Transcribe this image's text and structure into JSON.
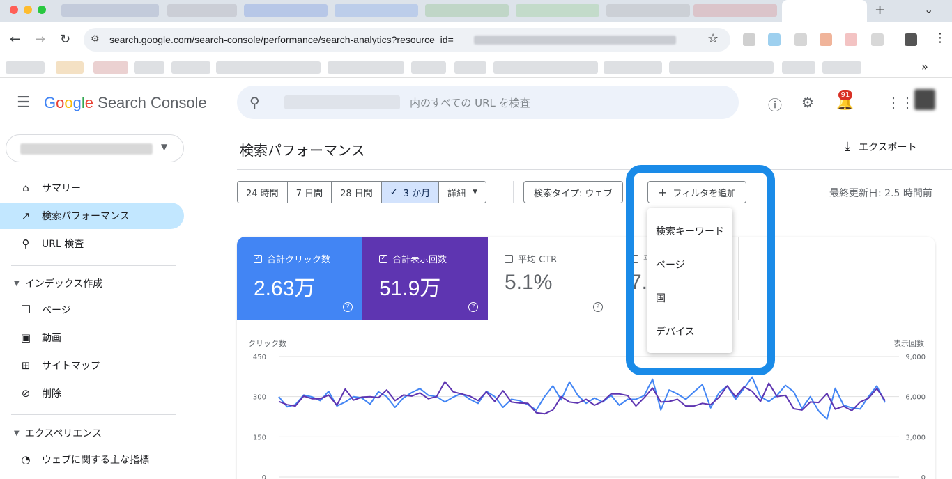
{
  "browser": {
    "url": "search.google.com/search-console/performance/search-analytics?resource_id="
  },
  "header": {
    "logo_google": [
      "G",
      "o",
      "o",
      "g",
      "l",
      "e"
    ],
    "logo_product": "Search Console",
    "search_placeholder": "内のすべての URL を検査",
    "notification_count": "91"
  },
  "sidebar": {
    "items": [
      {
        "label": "サマリー",
        "icon": "home-icon"
      },
      {
        "label": "検索パフォーマンス",
        "icon": "trending-up-icon"
      },
      {
        "label": "URL 検査",
        "icon": "search-icon"
      }
    ],
    "index_section": "インデックス作成",
    "index_items": [
      {
        "label": "ページ",
        "icon": "pages-icon"
      },
      {
        "label": "動画",
        "icon": "video-icon"
      },
      {
        "label": "サイトマップ",
        "icon": "sitemap-icon"
      },
      {
        "label": "削除",
        "icon": "removals-icon"
      }
    ],
    "experience_section": "エクスペリエンス",
    "experience_items": [
      {
        "label": "ウェブに関する主な指標",
        "icon": "gauge-icon"
      }
    ]
  },
  "main": {
    "title": "検索パフォーマンス",
    "export_label": "エクスポート",
    "date_ranges": [
      "24 時間",
      "7 日間",
      "28 日間",
      "3 か月",
      "詳細"
    ],
    "selected_range": "3 か月",
    "search_type_chip": "検索タイプ: ウェブ",
    "add_filter_chip": "フィルタを追加",
    "last_updated": "最終更新日: 2.5 時間前"
  },
  "metrics": [
    {
      "label": "合計クリック数",
      "value": "2.63万",
      "checked": true,
      "color": "#4285f4"
    },
    {
      "label": "合計表示回数",
      "value": "51.9万",
      "checked": true,
      "color": "#5e35b1"
    },
    {
      "label": "平均 CTR",
      "value": "5.1%",
      "checked": false
    },
    {
      "label": "平",
      "value": "7.",
      "checked": false
    }
  ],
  "filter_menu": [
    "検索キーワード",
    "ページ",
    "国",
    "デバイス"
  ],
  "chart_data": {
    "type": "line",
    "left_axis_label": "クリック数",
    "right_axis_label": "表示回数",
    "left_ticks": [
      "450",
      "300",
      "150",
      "0"
    ],
    "right_ticks": [
      "9,000",
      "6,000",
      "3,000",
      "0"
    ],
    "ylim_left": [
      0,
      450
    ],
    "ylim_right": [
      0,
      9000
    ],
    "series": [
      {
        "color": "#4285f4",
        "values": [
          300,
          262,
          270,
          306,
          299,
          285,
          320,
          265,
          280,
          300,
          295,
          272,
          318,
          300,
          260,
          295,
          315,
          330,
          305,
          300,
          280,
          298,
          312,
          290,
          275,
          320,
          300,
          260,
          290,
          285,
          270,
          250,
          300,
          340,
          288,
          355,
          305,
          275,
          295,
          280,
          305,
          268,
          290,
          290,
          304,
          365,
          250,
          325,
          310,
          290,
          318,
          345,
          258,
          314,
          340,
          290,
          330,
          373,
          300,
          282,
          305,
          342,
          318,
          256,
          300,
          246,
          216,
          331,
          268,
          258,
          254,
          300,
          340,
          278
        ]
      },
      {
        "color": "#5e35b1",
        "values": [
          282,
          270,
          265,
          302,
          292,
          292,
          306,
          268,
          328,
          287,
          298,
          300,
          296,
          325,
          285,
          306,
          302,
          314,
          292,
          300,
          356,
          318,
          310,
          302,
          285,
          318,
          282,
          322,
          280,
          276,
          275,
          240,
          236,
          250,
          300,
          280,
          276,
          290,
          268,
          282,
          310,
          310,
          304,
          265,
          296,
          332,
          280,
          282,
          290,
          265,
          265,
          275,
          270,
          297,
          340,
          300,
          336,
          320,
          282,
          350,
          300,
          305,
          255,
          250,
          280,
          278,
          312,
          253,
          264,
          248,
          280,
          294,
          330,
          285
        ]
      }
    ]
  },
  "colors": {
    "accent_blue": "#4285f4",
    "accent_purple": "#5e35b1",
    "highlight": "#1a8be8",
    "active_nav": "#c2e7ff"
  }
}
